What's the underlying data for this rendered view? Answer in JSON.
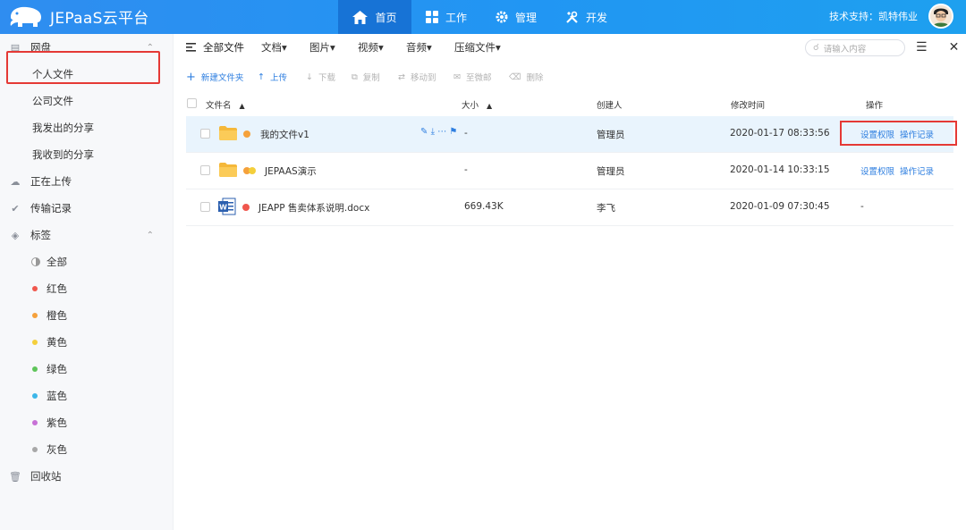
{
  "app": {
    "title": "JEPaaS云平台"
  },
  "nav": [
    {
      "label": "首页",
      "icon": "home-icon",
      "active": true
    },
    {
      "label": "工作",
      "icon": "grid-icon",
      "active": false
    },
    {
      "label": "管理",
      "icon": "gear-icon",
      "active": false
    },
    {
      "label": "开发",
      "icon": "tools-icon",
      "active": false
    }
  ],
  "support": {
    "label": "技术支持：凯特伟业"
  },
  "sidebar": {
    "netdisk": "网盘",
    "personal": "个人文件",
    "company": "公司文件",
    "shared_out": "我发出的分享",
    "shared_in": "我收到的分享",
    "uploading": "正在上传",
    "transfer": "传输记录",
    "tags": "标签",
    "tag_items": [
      {
        "label": "全部",
        "color": ""
      },
      {
        "label": "红色",
        "color": "#f0574d"
      },
      {
        "label": "橙色",
        "color": "#f5a13b"
      },
      {
        "label": "黄色",
        "color": "#f4cf3b"
      },
      {
        "label": "绿色",
        "color": "#5fc55a"
      },
      {
        "label": "蓝色",
        "color": "#3cb6e8"
      },
      {
        "label": "紫色",
        "color": "#c771d6"
      },
      {
        "label": "灰色",
        "color": "#a8a8a8"
      }
    ],
    "recycle": "回收站"
  },
  "toolbar": {
    "title": "全部文件",
    "menus": [
      "文档▾",
      "图片▾",
      "视频▾",
      "音频▾",
      "压缩文件▾"
    ],
    "search_placeholder": "请输入内容"
  },
  "actions": {
    "new_folder": "新建文件夹",
    "upload": "上传",
    "download": "下载",
    "copy": "复制",
    "move": "移动到",
    "email": "至微邮",
    "delete": "删除"
  },
  "table": {
    "headers": {
      "name": "文件名",
      "size": "大小",
      "creator": "创建人",
      "modified": "修改时间",
      "ops": "操作"
    },
    "rows": [
      {
        "name": "我的文件v1",
        "size": "-",
        "creator": "管理员",
        "modified": "2020-01-17 08:33:56",
        "op1": "设置权限",
        "op2": "操作记录"
      },
      {
        "name": "JEPAAS演示",
        "size": "-",
        "creator": "管理员",
        "modified": "2020-01-14 10:33:15",
        "op1": "设置权限",
        "op2": "操作记录"
      },
      {
        "name": "JEAPP 售卖体系说明.docx",
        "size": "669.43K",
        "creator": "李飞",
        "modified": "2020-01-09 07:30:45",
        "op1": "-"
      }
    ]
  },
  "colors": {
    "accent": "#2196f3",
    "highlight": "#e53935",
    "link": "#2f7fe0"
  }
}
